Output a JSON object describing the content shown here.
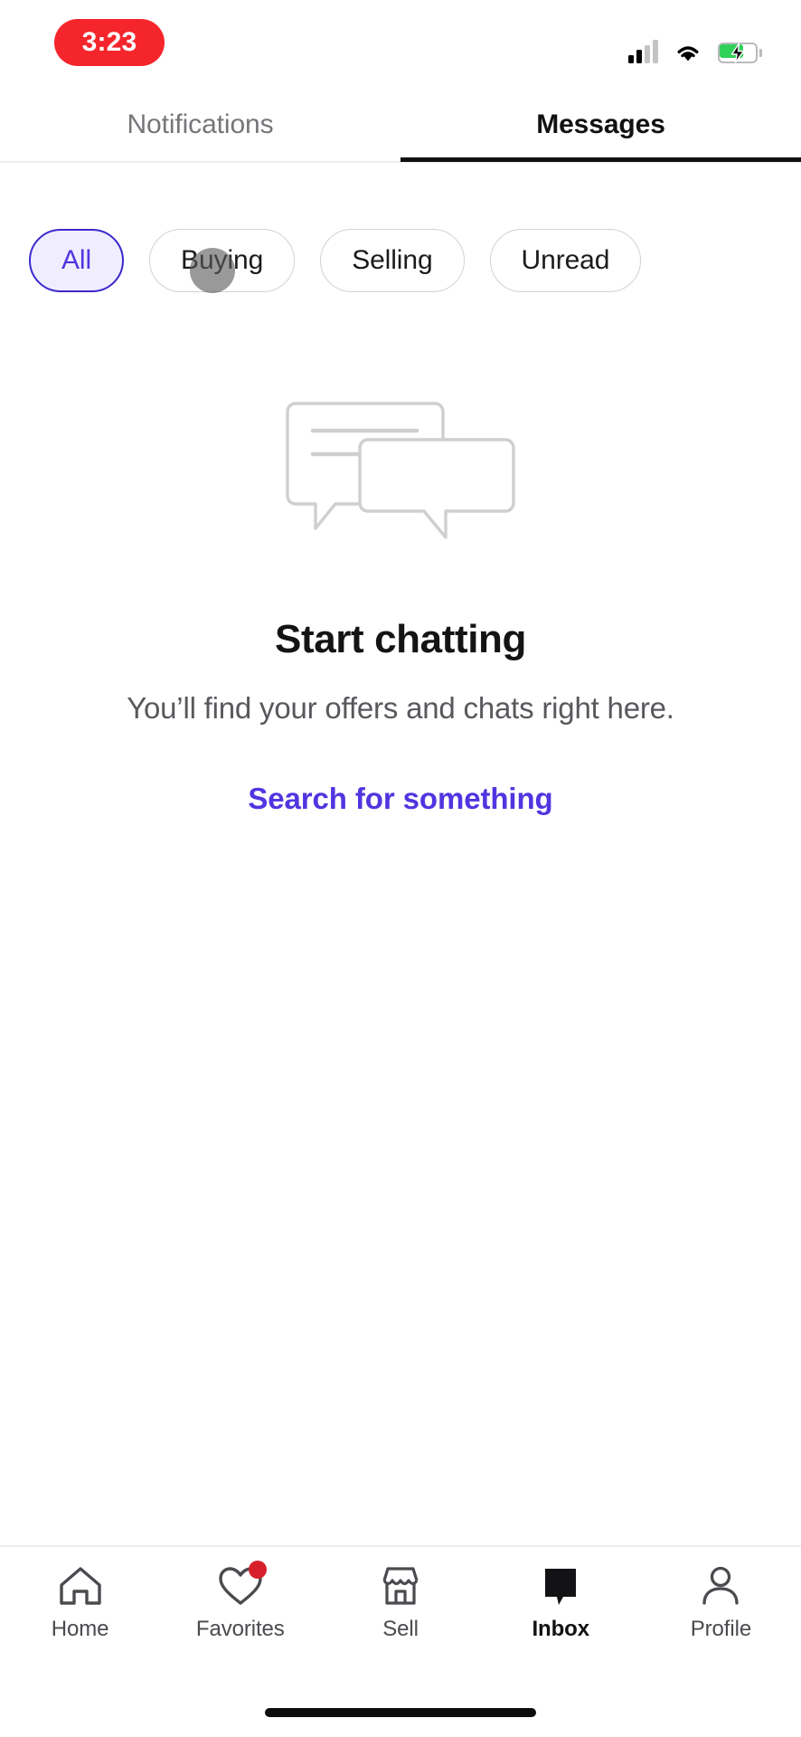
{
  "status_bar": {
    "recording_time": "3:23",
    "icons": {
      "signal": "cellular-signal-icon",
      "wifi": "wifi-icon",
      "battery": "battery-charging-icon"
    },
    "colors": {
      "recording_pill": "#f5252c",
      "battery_fill": "#30d158"
    }
  },
  "top_tabs": {
    "items": [
      {
        "label": "Notifications",
        "active": false
      },
      {
        "label": "Messages",
        "active": true
      }
    ]
  },
  "filters": {
    "chips": [
      {
        "label": "All",
        "selected": true
      },
      {
        "label": "Buying",
        "selected": false
      },
      {
        "label": "Selling",
        "selected": false
      },
      {
        "label": "Unread",
        "selected": false
      }
    ],
    "touch_indicator_on": "Buying"
  },
  "empty_state": {
    "illustration": "chat-bubbles-illustration",
    "title": "Start chatting",
    "subtitle": "You’ll find your offers and chats right here.",
    "cta_label": "Search for something"
  },
  "bottom_nav": {
    "items": [
      {
        "label": "Home",
        "icon": "home-icon",
        "active": false,
        "badge": false
      },
      {
        "label": "Favorites",
        "icon": "heart-icon",
        "active": false,
        "badge": true
      },
      {
        "label": "Sell",
        "icon": "storefront-icon",
        "active": false,
        "badge": false
      },
      {
        "label": "Inbox",
        "icon": "chat-bubble-filled-icon",
        "active": true,
        "badge": false
      },
      {
        "label": "Profile",
        "icon": "person-icon",
        "active": false,
        "badge": false
      }
    ]
  },
  "colors": {
    "accent_purple": "#4f36e0",
    "chip_selected_border": "#3b28cc",
    "chip_selected_bg": "#f0edff",
    "badge_red": "#d61f2b",
    "text_primary": "#111113",
    "text_secondary": "#58585d"
  }
}
